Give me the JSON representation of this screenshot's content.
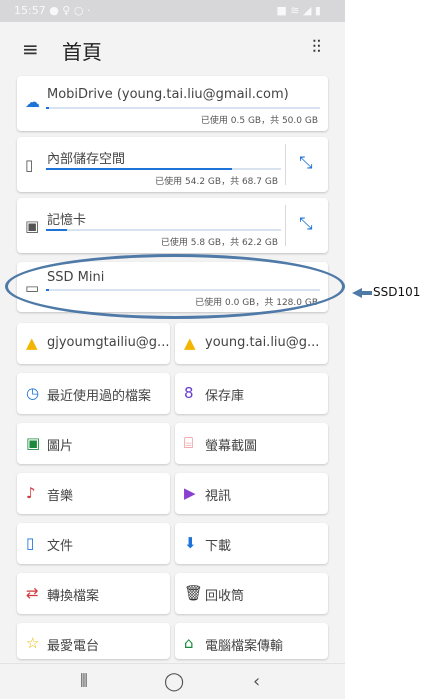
{
  "status": {
    "time": "15:57 ● ♀ ○ ·",
    "right": "■ ≋ ◢ ▮"
  },
  "header": {
    "title": "首頁"
  },
  "storage": [
    {
      "name": "MobiDrive (young.tai.liu@gmail.com)",
      "usage": "已使用 0.5 GB，共 50.0 GB",
      "fill_fraction": 0.01
    },
    {
      "name": "內部儲存空間",
      "usage": "已使用 54.2 GB，共 68.7 GB",
      "fill_fraction": 0.79
    },
    {
      "name": "記憶卡",
      "usage": "已使用 5.8 GB，共 62.2 GB",
      "fill_fraction": 0.09
    },
    {
      "name": "SSD Mini",
      "usage": "已使用 0.0 GB，共 128.0 GB",
      "fill_fraction": 0.0
    }
  ],
  "tiles": [
    {
      "label": "gjyoumgtailiu@g...",
      "icon": "google-drive-icon"
    },
    {
      "label": "young.tai.liu@g...",
      "icon": "google-drive-icon"
    },
    {
      "label": "最近使用過的檔案",
      "icon": "clock-icon"
    },
    {
      "label": "保存庫",
      "icon": "vault-icon"
    },
    {
      "label": "圖片",
      "icon": "image-icon"
    },
    {
      "label": "螢幕截圖",
      "icon": "screenshot-icon"
    },
    {
      "label": "音樂",
      "icon": "music-icon"
    },
    {
      "label": "視訊",
      "icon": "video-icon"
    },
    {
      "label": "文件",
      "icon": "document-icon"
    },
    {
      "label": "下載",
      "icon": "download-icon"
    },
    {
      "label": "轉換檔案",
      "icon": "convert-icon"
    },
    {
      "label": "回收筒",
      "icon": "trash-icon"
    },
    {
      "label": "最愛電台",
      "icon": "star-icon"
    },
    {
      "label": "電腦檔案傳輸",
      "icon": "pc-transfer-icon"
    }
  ],
  "annotation": {
    "label": "SSD101"
  },
  "colors": {
    "accent": "#1e73d8",
    "annotation": "#4f79a7"
  }
}
